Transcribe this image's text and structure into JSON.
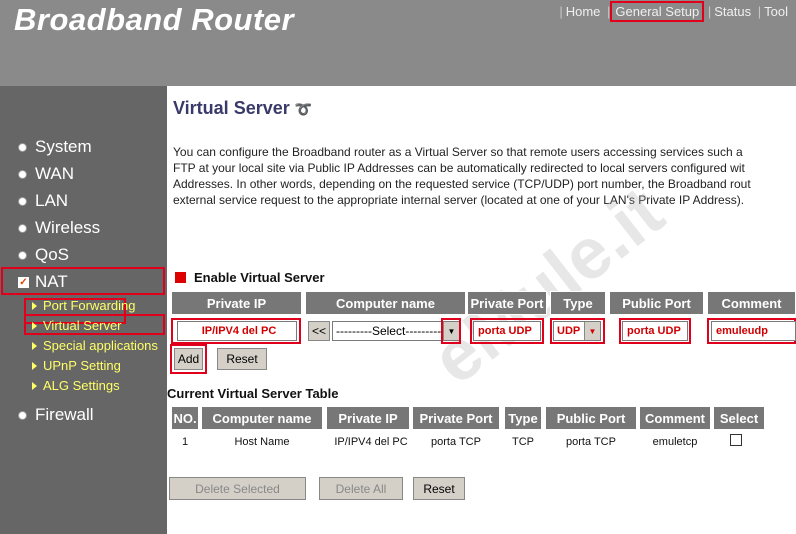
{
  "header": {
    "brand": "Broadband Router",
    "nav": [
      "Home",
      "General Setup",
      "Status",
      "Tool"
    ]
  },
  "sidebar": {
    "items": [
      "System",
      "WAN",
      "LAN",
      "Wireless",
      "QoS",
      "NAT",
      "Firewall"
    ],
    "nat_sub": [
      "Port Forwarding",
      "Virtual Server",
      "Special applications",
      "UPnP Setting",
      "ALG Settings"
    ]
  },
  "page": {
    "title": "Virtual Server",
    "description": "You can configure the Broadband router as a Virtual Server so that remote users accessing services such a\nFTP at your local site via Public IP Addresses can be automatically redirected to local servers configured wit\nAddresses. In other words, depending on the requested service (TCP/UDP) port number, the Broadband rout\nexternal service request to the appropriate internal server (located at one of your LAN's Private IP Address).",
    "watermark": "eMule.it",
    "enable_label": "Enable Virtual Server"
  },
  "form": {
    "headers": [
      "Private IP",
      "Computer name",
      "Private Port",
      "Type",
      "Public Port",
      "Comment"
    ],
    "private_ip": "IP/IPV4 del PC",
    "copy_button": "<<",
    "computer_select": "---------Select---------",
    "private_port": "porta UDP",
    "type": "UDP",
    "public_port": "porta UDP",
    "comment": "emuleudp",
    "add_label": "Add",
    "reset_label": "Reset"
  },
  "table": {
    "title": "Current Virtual Server Table",
    "headers": [
      "NO.",
      "Computer name",
      "Private IP",
      "Private Port",
      "Type",
      "Public Port",
      "Comment",
      "Select"
    ],
    "rows": [
      [
        "1",
        "Host Name",
        "IP/IPV4 del PC",
        "porta TCP",
        "TCP",
        "porta TCP",
        "emuletcp"
      ]
    ],
    "delete_selected": "Delete Selected",
    "delete_all": "Delete All",
    "reset": "Reset"
  }
}
